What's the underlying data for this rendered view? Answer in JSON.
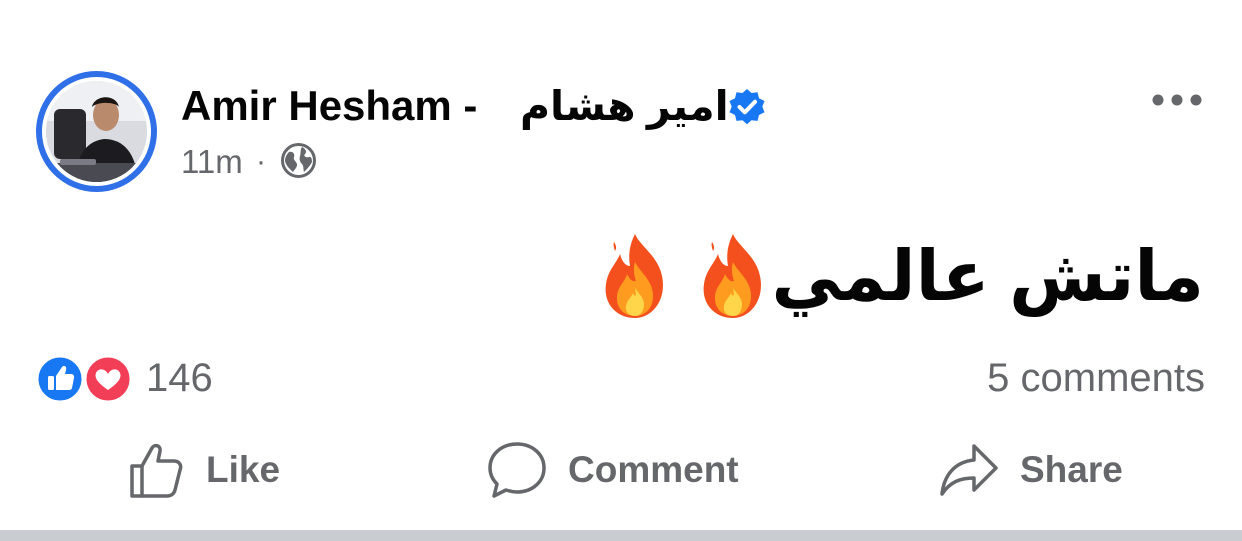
{
  "post": {
    "author": {
      "name": "Amir Hesham -",
      "name_arabic": "امير هشام",
      "verified_icon": "verified-badge-icon"
    },
    "meta": {
      "time": "11m",
      "separator": "·",
      "audience_icon": "globe-icon"
    },
    "more_icon": "more-options-icon",
    "body": {
      "text": "ماتش عالمي",
      "emoji": [
        "🔥",
        "🔥"
      ]
    },
    "reactions": {
      "icons": [
        "like-reaction-icon",
        "love-reaction-icon"
      ],
      "count": "146"
    },
    "comments": {
      "count_label": "5 comments"
    },
    "actions": {
      "like_label": "Like",
      "comment_label": "Comment",
      "share_label": "Share"
    }
  },
  "colors": {
    "text_primary": "#050505",
    "text_secondary": "#65676b",
    "brand_blue": "#1877f2",
    "story_ring": "#2f6fe8",
    "love_red": "#f33e58",
    "divider": "#c9ccd1"
  }
}
